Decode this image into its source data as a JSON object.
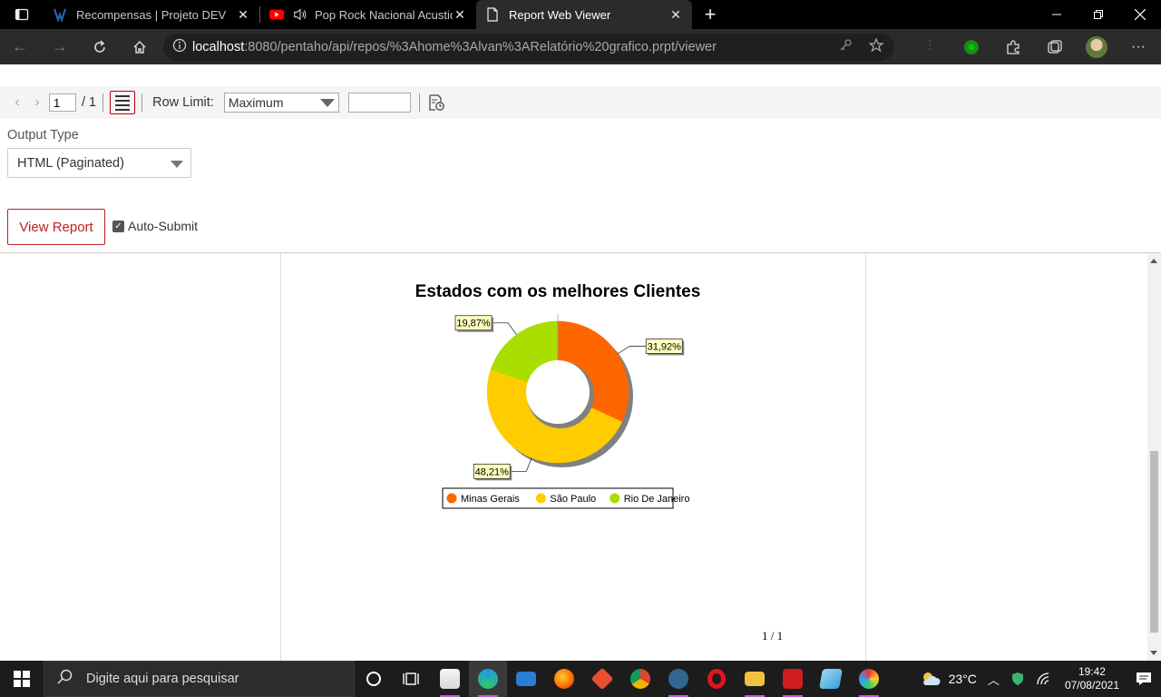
{
  "browser": {
    "tabs": [
      {
        "title": "Recompensas | Projeto DEV",
        "active": false
      },
      {
        "title": "Pop Rock Nacional Acustico",
        "active": false
      },
      {
        "title": "Report Web Viewer",
        "active": true
      }
    ],
    "url_host": "localhost",
    "url_path": ":8080/pentaho/api/repos/%3Ahome%3Alvan%3ARelatório%20grafico.prpt/viewer"
  },
  "toolbar": {
    "page_current": "1",
    "page_total": "/ 1",
    "row_limit_label": "Row Limit:",
    "row_limit_value": "Maximum",
    "row_limit_input": ""
  },
  "parameters": {
    "output_type_label": "Output Type",
    "output_type_value": "HTML (Paginated)",
    "view_report_label": "View Report",
    "auto_submit_label": "Auto-Submit",
    "auto_submit_checked": true
  },
  "report": {
    "page_counter": "1 / 1"
  },
  "chart_data": {
    "type": "pie",
    "title": "Estados com os melhores Clientes",
    "categories": [
      "Minas Gerais",
      "São Paulo",
      "Rio De Janeiro"
    ],
    "values": [
      31.92,
      48.21,
      19.87
    ],
    "value_labels": [
      "31,92%",
      "48,21%",
      "19,87%"
    ],
    "colors": [
      "#ff6600",
      "#ffcc00",
      "#aadd00"
    ],
    "donut": true,
    "legend_position": "bottom"
  },
  "taskbar": {
    "search_placeholder": "Digite aqui para pesquisar",
    "weather": "23°C",
    "time": "19:42",
    "date": "07/08/2021"
  }
}
